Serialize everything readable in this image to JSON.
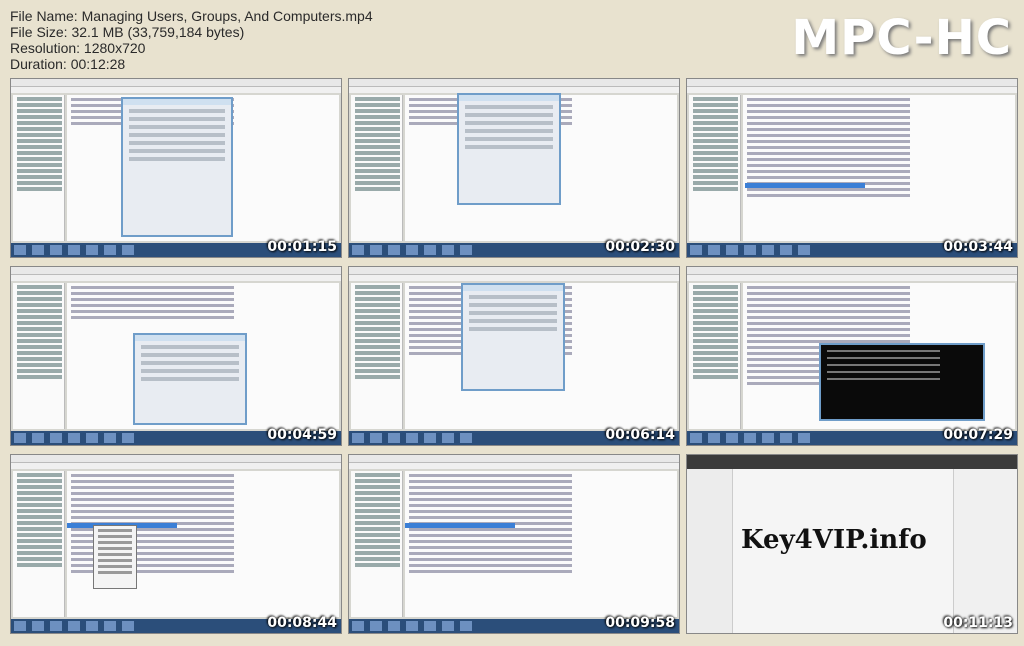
{
  "info": {
    "file_name": "File Name: Managing Users, Groups, And Computers.mp4",
    "file_size": "File Size: 32.1 MB (33,759,184 bytes)",
    "resolution": "Resolution: 1280x720",
    "duration": "Duration: 00:12:28"
  },
  "logo": "MPC-HC",
  "thumbnails": [
    {
      "timestamp": "00:01:15"
    },
    {
      "timestamp": "00:02:30"
    },
    {
      "timestamp": "00:03:44"
    },
    {
      "timestamp": "00:04:59"
    },
    {
      "timestamp": "00:06:14"
    },
    {
      "timestamp": "00:07:29"
    },
    {
      "timestamp": "00:08:44"
    },
    {
      "timestamp": "00:09:58"
    },
    {
      "timestamp": "00:11:13",
      "watermark": "Key4VIP.info"
    }
  ]
}
